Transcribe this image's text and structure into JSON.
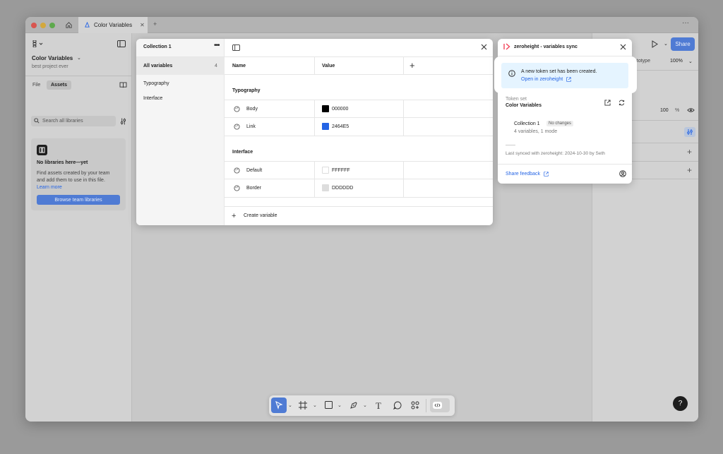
{
  "tab": {
    "title": "Color Variables"
  },
  "left": {
    "file_name": "Color Variables",
    "file_desc": "best project ever",
    "tabs": [
      "File",
      "Assets"
    ],
    "search_placeholder": "Search all libraries",
    "empty_title": "No libraries here—yet",
    "empty_text_1": "Find assets created by your team",
    "empty_text_2": "and add them to use in this file.",
    "learn_more": "Learn more",
    "browse_button": "Browse team libraries"
  },
  "right": {
    "share": "Share",
    "prototype_fragment": "ototype",
    "zoom": "100%",
    "opacity": "100",
    "percent": "%"
  },
  "variables": {
    "collection": "Collection 1",
    "all_variables": "All variables",
    "all_count": "4",
    "groups": [
      "Typography",
      "Interface"
    ],
    "col_name": "Name",
    "col_value": "Value",
    "sections": [
      {
        "title": "Typography",
        "rows": [
          {
            "name": "Body",
            "value": "000000",
            "color": "#000000"
          },
          {
            "name": "Link",
            "value": "2464E5",
            "color": "#2464E5"
          }
        ]
      },
      {
        "title": "Interface",
        "rows": [
          {
            "name": "Default",
            "value": "FFFFFF",
            "color": "#FFFFFF"
          },
          {
            "name": "Border",
            "value": "DDDDDD",
            "color": "#DDDDDD"
          }
        ]
      }
    ],
    "create": "Create variable"
  },
  "plugin": {
    "title": "zeroheight - variables sync",
    "toast_text": "A new token set has been created.",
    "toast_link": "Open in zeroheight",
    "token_set_label": "Token set",
    "token_set_name": "Color Variables",
    "collection": "Collection 1",
    "badge": "No changes",
    "summary": "4 variables, 1 mode",
    "last_synced": "Last synced with zeroheight: 2024-10-30 by Seth",
    "feedback": "Share feedback"
  },
  "help": "?",
  "colors": {
    "accent": "#2464E5",
    "toast_bg": "#E5F4FF",
    "brand": "#F2445A"
  }
}
